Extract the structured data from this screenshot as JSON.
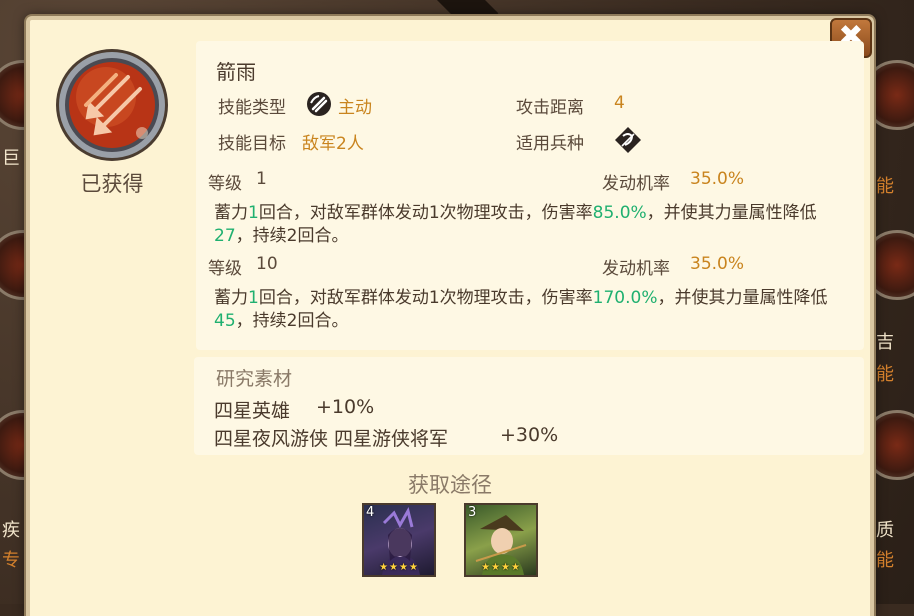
{
  "background": {
    "left_labels": [
      "巨",
      "疾",
      "专"
    ],
    "right_labels": [
      "能",
      "吉",
      "能",
      "质",
      "能"
    ]
  },
  "skill": {
    "name": "箭雨",
    "status": "已获得",
    "type_label": "技能类型",
    "type_value": "主动",
    "target_label": "技能目标",
    "target_value": "敌军2人",
    "range_label": "攻击距离",
    "range_value": "4",
    "troop_label": "适用兵种",
    "icon": "arrow-rain-icon",
    "type_icon": "active-skill-icon",
    "troop_icon": "archer-troop-icon"
  },
  "levels": [
    {
      "label": "等级",
      "level": "1",
      "rate_label": "发动机率",
      "rate": "35.0%",
      "desc": {
        "p1": "蓄力",
        "charge": "1",
        "p2": "回合，对敌军群体发动1次物理攻击，伤害率",
        "dmg": "85.0%",
        "p3": "，并使其力量属性降低",
        "reduce": "27",
        "p4": "，持续2回合。"
      }
    },
    {
      "label": "等级",
      "level": "10",
      "rate_label": "发动机率",
      "rate": "35.0%",
      "desc": {
        "p1": "蓄力",
        "charge": "1",
        "p2": "回合，对敌军群体发动1次物理攻击，伤害率",
        "dmg": "170.0%",
        "p3": "，并使其力量属性降低",
        "reduce": "45",
        "p4": "，持续2回合。"
      }
    }
  ],
  "materials": {
    "title": "研究素材",
    "rows": [
      {
        "heroes": "四星英雄",
        "bonus": "+10%"
      },
      {
        "heroes": "四星夜风游侠 四星游侠将军",
        "bonus": "+30%"
      }
    ]
  },
  "sources": {
    "title": "获取途径",
    "heroes": [
      {
        "level": "4",
        "stars": "★★★★"
      },
      {
        "level": "3",
        "stars": "★★★★"
      }
    ]
  },
  "close_label": "✖",
  "colors": {
    "accent": "#c9841e",
    "green": "#20b070",
    "panel": "#fef8e4"
  }
}
